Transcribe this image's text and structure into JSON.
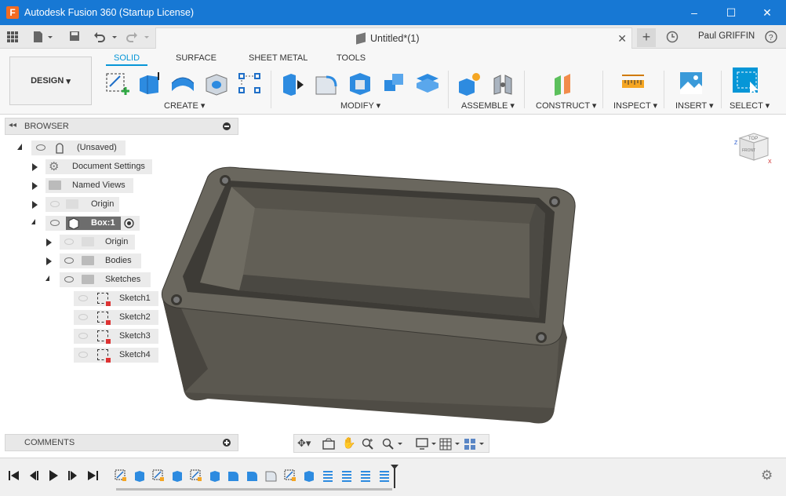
{
  "window": {
    "title": "Autodesk Fusion 360 (Startup License)",
    "app_icon_letter": "F",
    "controls": [
      "–",
      "☐",
      "✕"
    ]
  },
  "tabbar": {
    "document_tab": "Untitled*(1)",
    "user": "Paul GRIFFIN"
  },
  "ribbon": {
    "workspace": "DESIGN",
    "tabs": [
      "SOLID",
      "SURFACE",
      "SHEET METAL",
      "TOOLS"
    ],
    "active_tab": "SOLID",
    "groups": [
      "CREATE",
      "MODIFY",
      "ASSEMBLE",
      "CONSTRUCT",
      "INSPECT",
      "INSERT",
      "SELECT"
    ]
  },
  "browser": {
    "title": "BROWSER",
    "nodes": {
      "root": "(Unsaved)",
      "document_settings": "Document Settings",
      "named_views": "Named Views",
      "origin": "Origin",
      "component": "Box:1",
      "comp_origin": "Origin",
      "bodies": "Bodies",
      "sketches": "Sketches",
      "sketch1": "Sketch1",
      "sketch2": "Sketch2",
      "sketch3": "Sketch3",
      "sketch4": "Sketch4"
    }
  },
  "comments": {
    "title": "COMMENTS"
  },
  "viewcube": {
    "face_top": "TOP",
    "face_front": "FRONT",
    "axis_z": "Z",
    "axis_x": "X"
  },
  "colors": {
    "titlebar": "#1778d4",
    "accent": "#0696d7",
    "model": "#5d5a52"
  }
}
